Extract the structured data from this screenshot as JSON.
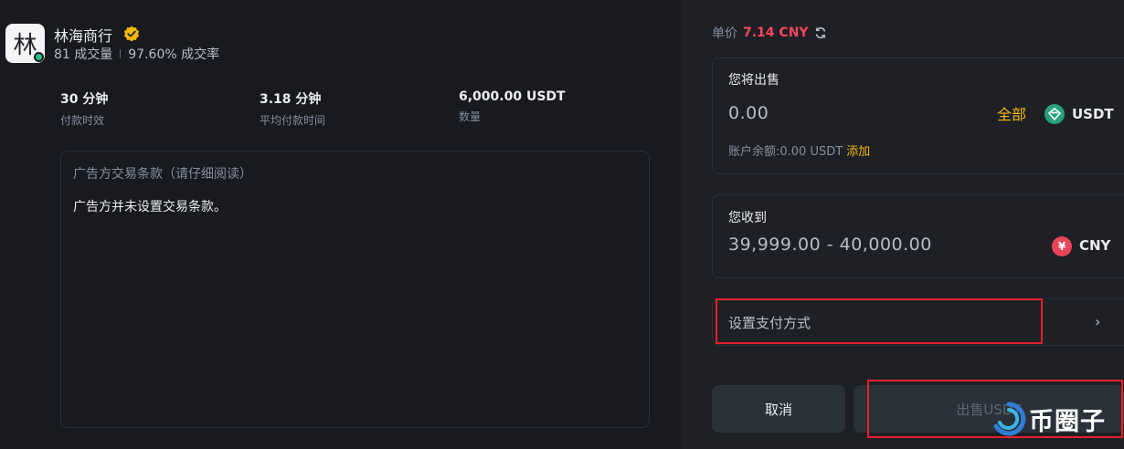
{
  "merchant": {
    "avatar_char": "林",
    "name": "林海商行",
    "orders": "81 成交量",
    "completion": "97.60% 成交率"
  },
  "stats": [
    {
      "value": "30 分钟",
      "label": "付款时效"
    },
    {
      "value": "3.18 分钟",
      "label": "平均付款时间"
    },
    {
      "value": "6,000.00 USDT",
      "label": "数量"
    }
  ],
  "terms": {
    "title": "广告方交易条款（请仔细阅读）",
    "content": "广告方并未设置交易条款。"
  },
  "price": {
    "label": "单价",
    "value": "7.14 CNY"
  },
  "sell_card": {
    "label": "您将出售",
    "amount": "0.00",
    "all_label": "全部",
    "coin": "USDT",
    "balance": "账户余额:0.00 USDT",
    "add_label": "添加"
  },
  "receive_card": {
    "label": "您收到",
    "amount": "39,999.00 - 40,000.00",
    "coin": "CNY",
    "coin_symbol": "¥"
  },
  "payment": {
    "label": "设置支付方式"
  },
  "buttons": {
    "cancel": "取消",
    "sell": "出售USDT"
  },
  "watermark": {
    "text": "币圈子"
  },
  "colors": {
    "accent": "#f0b90b",
    "price": "#f6465d",
    "usdt": "#26a17b",
    "cny": "#e8445a",
    "annotation": "#e8202a"
  }
}
